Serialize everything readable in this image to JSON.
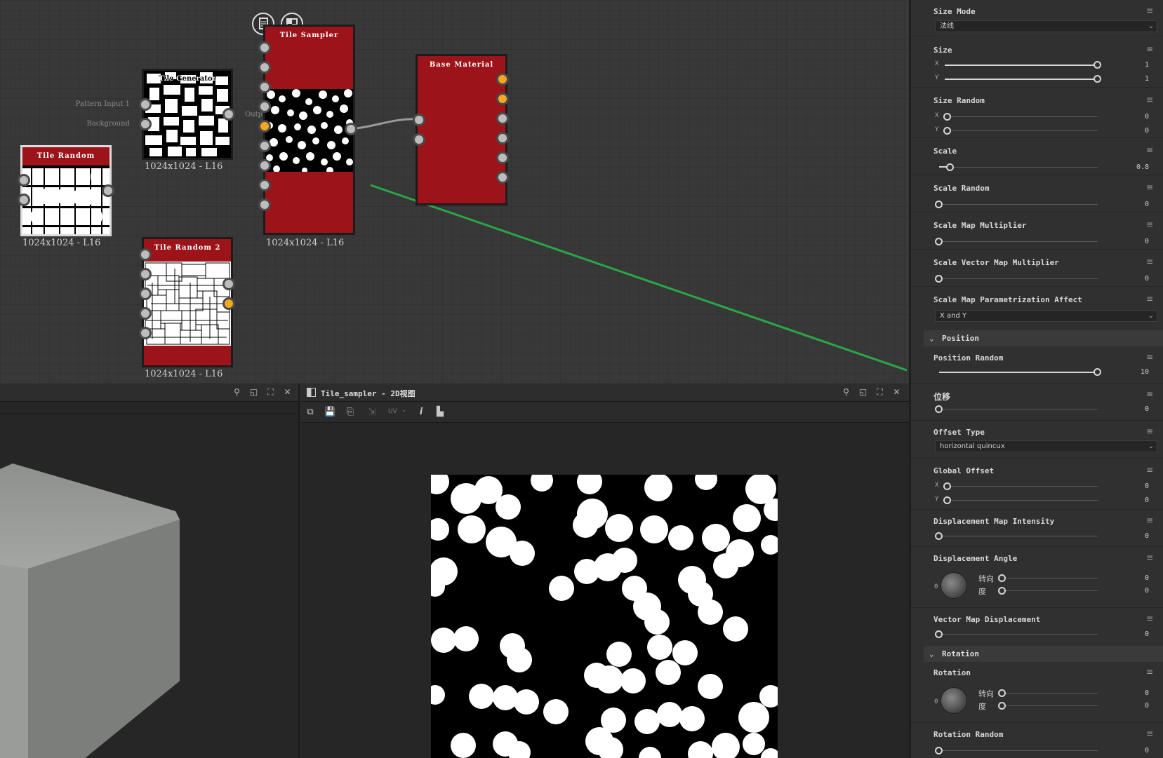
{
  "graph": {
    "nodes": {
      "tile_random": {
        "title": "Tile Random",
        "res": "1024x1024 - L16"
      },
      "tile_generator": {
        "title": "Tile Generator",
        "res": "1024x1024 - L16",
        "port_in_1": "Pattern Input 1",
        "port_in_2": "Background",
        "port_out": "Output"
      },
      "tile_random_2": {
        "title": "Tile Random 2",
        "res": "1024x1024 - L16"
      },
      "tile_sampler": {
        "title": "Tile Sampler",
        "res": "1024x1024 - L16"
      },
      "base_material": {
        "title": "Base Material"
      }
    },
    "top_icons": [
      "document-icon",
      "checker-icon"
    ],
    "annotation_color": "#2aa646",
    "node_color": "#9c1319",
    "port_orange": "#f5a623"
  },
  "view2d": {
    "title": "Tile_sampler - 2D视图",
    "uv_label": "UV"
  },
  "props": {
    "size_mode": {
      "label": "Size Mode",
      "value": "法线"
    },
    "size": {
      "label": "Size",
      "x": "1",
      "y": "1",
      "x_frac": 1.0,
      "y_frac": 1.0
    },
    "size_random": {
      "label": "Size Random",
      "x": "0",
      "y": "0"
    },
    "scale": {
      "label": "Scale",
      "value": "0.8"
    },
    "scale_random": {
      "label": "Scale Random",
      "value": "0"
    },
    "scale_map_multiplier": {
      "label": "Scale Map Multiplier",
      "value": "0"
    },
    "scale_vector_map_multiplier": {
      "label": "Scale Vector Map Multiplier",
      "value": "0"
    },
    "scale_map_param_affect": {
      "label": "Scale Map Parametrization Affect",
      "value": "X and Y"
    },
    "position_section": "Position",
    "position_random": {
      "label": "Position Random",
      "value": "10"
    },
    "offset": {
      "label": "位移",
      "value": "0"
    },
    "offset_type": {
      "label": "Offset Type",
      "value": "horizontal quincux"
    },
    "global_offset": {
      "label": "Global Offset",
      "x": "0",
      "y": "0"
    },
    "displacement_map_intensity": {
      "label": "Displacement Map Intensity",
      "value": "0"
    },
    "displacement_angle": {
      "label": "Displacement Angle",
      "turn_label": "转向",
      "deg_label": "度",
      "turn": "0",
      "deg": "0",
      "dial_zero": "0"
    },
    "vector_map_displacement": {
      "label": "Vector Map Displacement",
      "value": "0"
    },
    "rotation_section": "Rotation",
    "rotation": {
      "label": "Rotation",
      "turn_label": "转向",
      "deg_label": "度",
      "turn": "0",
      "deg": "0",
      "dial_zero": "0"
    },
    "rotation_random": {
      "label": "Rotation Random",
      "value": "0"
    },
    "x_label": "X",
    "y_label": "Y"
  }
}
